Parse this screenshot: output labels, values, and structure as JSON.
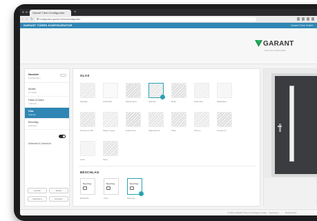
{
  "browser": {
    "tab_title": "Garant Türen Konfigurator",
    "new_tab": "+",
    "url": "konfigurator.garant.de/tuerkonfigurator"
  },
  "app": {
    "title": "GARANT TÜREN KONFIGURATOR",
    "user_label": "Garant Türen GmbH"
  },
  "brand": {
    "name": "GARANT",
    "tagline": "Türen aus Leidenschaft",
    "accent_color": "#2f86b4",
    "highlight_color": "#2aa3b3",
    "logo_green": "#1e9a52"
  },
  "sidebar": {
    "header_title": "Haustüre",
    "header_sub": "Konfiguration",
    "items": [
      {
        "title": "Modell",
        "sub": "GT 1000"
      },
      {
        "title": "Farbe & Dekor",
        "sub": "Anthrazit"
      },
      {
        "title": "Glas",
        "sub": "Satinato"
      },
      {
        "title": "Beschlag",
        "sub": "Edelstahl"
      }
    ],
    "toggle_label": "Seitenteil & Oberlicht",
    "buttons": [
      "Zurück",
      "Weiter",
      "Speichern",
      "Drucken"
    ]
  },
  "glass": {
    "title": "GLAS",
    "items": [
      {
        "label": "Klarglas",
        "tone": "#e9e9e9"
      },
      {
        "label": "Chinchilla",
        "tone": "#f7f7f7"
      },
      {
        "label": "Mastercarré",
        "tone": "#dcdcdc"
      },
      {
        "label": "Satinato",
        "tone": "#e5e5e5"
      },
      {
        "label": "Reflo",
        "tone": "#dedede"
      },
      {
        "label": "Kathedral",
        "tone": "#efefef"
      },
      {
        "label": "Mastiglass",
        "tone": "#f4f4f4"
      },
      {
        "label": "Ornament 504",
        "tone": "#e2e2e2"
      },
      {
        "label": "Master Ligne",
        "tone": "#ebebeb"
      },
      {
        "label": "Delta Frost",
        "tone": "#dcdcdc"
      },
      {
        "label": "Altdeutsch K",
        "tone": "#e4e4e4"
      },
      {
        "label": "Pave",
        "tone": "#e0e0e0"
      },
      {
        "label": "Screen",
        "tone": "#e8e8e8"
      },
      {
        "label": "Ornament",
        "tone": "#dddddd"
      },
      {
        "label": "Uadi",
        "tone": "#f1f1f1"
      },
      {
        "label": "Float",
        "tone": "#e2e2e2"
      }
    ],
    "selected_label": "Satinato"
  },
  "hardware": {
    "title": "BESCHLAG",
    "items": [
      {
        "label": "Edelstahl",
        "text": "Beschlag"
      },
      {
        "label": "Titan",
        "text": "Beschlag"
      },
      {
        "label": "Messing",
        "text": "Beschlag"
      }
    ],
    "selected_label": "Messing"
  },
  "preview": {
    "door_color": "#3a3c3f"
  },
  "footer": {
    "copyright": "© 2024 GARANT Türen und Zargen GmbH",
    "link1": "Impressum",
    "link2": "Datenschutz"
  }
}
